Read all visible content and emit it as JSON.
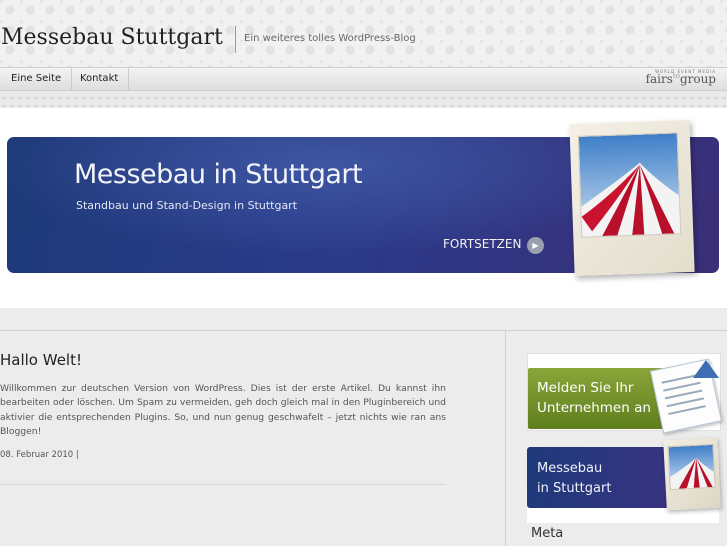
{
  "header": {
    "site_title": "Messebau Stuttgart",
    "tagline": "Ein weiteres tolles WordPress-Blog"
  },
  "nav": {
    "items": [
      {
        "label": "Eine Seite"
      },
      {
        "label": "Kontakt"
      }
    ],
    "brand_small": "WORLD EVENT MEDIA",
    "brand_name": "fairs",
    "brand_sup": "to",
    "brand_suffix": "group"
  },
  "slider": {
    "title": "Messebau in Stuttgart",
    "subtitle": "Standbau und Stand-Design in Stuttgart",
    "cta_label": "FORTSETZEN",
    "cta_icon": "play-arrow-icon"
  },
  "post": {
    "title": "Hallo Welt!",
    "body": "Willkommen zur deutschen Version von WordPress. Dies ist der erste Artikel. Du kannst ihn bearbeiten oder löschen. Um Spam zu vermeiden, geh doch gleich mal in den Pluginbereich und aktivier die entsprechenden Plugins. So, und nun genug geschwafelt – jetzt nichts wie ran ans Bloggen!",
    "meta": "08. Februar 2010 |"
  },
  "sidebar": {
    "ad1_line1": "Melden Sie Ihr",
    "ad1_line2": "Unternehmen an",
    "ad2_line1": "Messebau",
    "ad2_line2": "in Stuttgart",
    "meta_heading": "Meta"
  },
  "colors": {
    "banner_blue": "#1d3a78",
    "ad_green": "#7a9a2e",
    "arrow_blue": "#3f6db2"
  }
}
